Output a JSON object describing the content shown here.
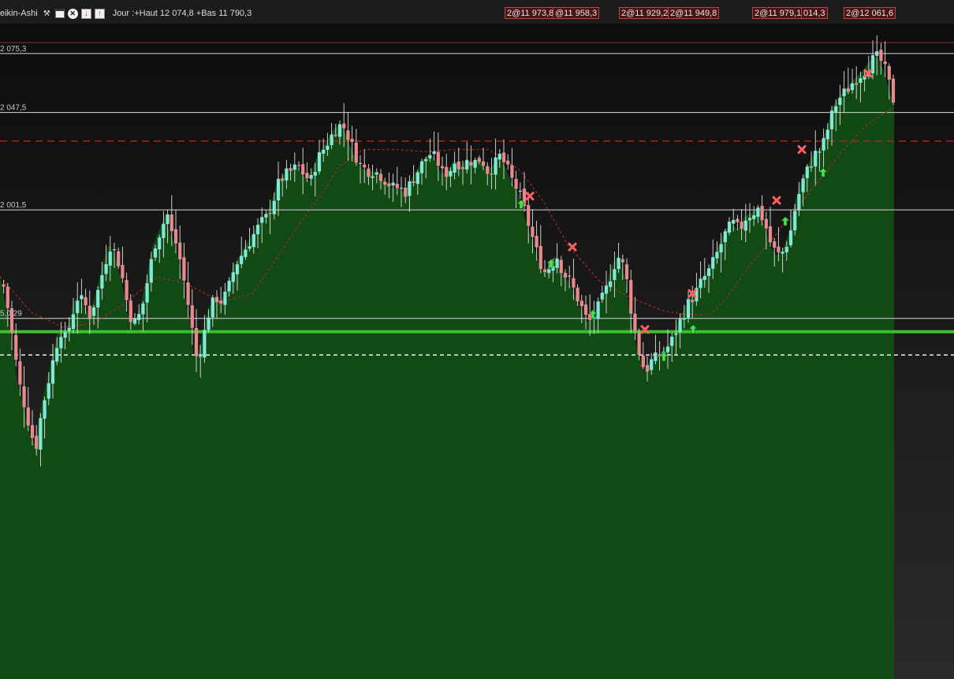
{
  "toolbar": {
    "style_name": "eikin-Ashi",
    "info_text": "Jour :+Haut 12 074,8 +Bas 11 790,3",
    "icons": [
      "wrench-icon",
      "window-icon",
      "close-icon",
      "sell-arrow-icon",
      "buy-arrow-icon"
    ]
  },
  "order_tags": {
    "t1": "2@11 973,8",
    "t2": "@11 958,3",
    "t3": "2@11 929,2",
    "t4": "2@11 949,8",
    "t5": "2@11 979,1",
    "t6": "014,3",
    "t7": "2@12 061,6"
  },
  "level_labels": {
    "l1": "2 075,3",
    "l2": "2 047,5",
    "l3": "2 001,5",
    "l4": "5,0,29"
  },
  "colors": {
    "background_top": "#0c0c0c",
    "background_bottom": "#2a2a2a",
    "bull_candle": "#7fe8d8",
    "bear_candle": "#e88a8a",
    "area_fill": "#124d14",
    "moving_average": "#b02828",
    "resistance_dashed": "#c02828",
    "support_line": "#3cbf32",
    "buy_marker": "#4fe04f",
    "sell_marker": "#ff6060"
  },
  "chart_data": {
    "type": "candlestick",
    "title": "",
    "xlabel": "",
    "ylabel": "",
    "ylim": [
      11780,
      12079
    ],
    "grid": false,
    "horizontal_levels": [
      12075.3,
      12047.5,
      12001.5,
      11950.29
    ],
    "resistance_level": 12034,
    "support_level": 11944,
    "dashed_level": 11933,
    "close_path": [
      [
        0,
        11970
      ],
      [
        8,
        11955
      ],
      [
        16,
        11935
      ],
      [
        22,
        11920
      ],
      [
        30,
        11908
      ],
      [
        38,
        11895
      ],
      [
        45,
        11890
      ],
      [
        50,
        11905
      ],
      [
        56,
        11915
      ],
      [
        62,
        11925
      ],
      [
        68,
        11935
      ],
      [
        74,
        11945
      ],
      [
        82,
        11940
      ],
      [
        88,
        11950
      ],
      [
        96,
        11960
      ],
      [
        104,
        11958
      ],
      [
        112,
        11952
      ],
      [
        120,
        11960
      ],
      [
        130,
        11975
      ],
      [
        138,
        11985
      ],
      [
        146,
        11980
      ],
      [
        154,
        11968
      ],
      [
        162,
        11952
      ],
      [
        170,
        11948
      ],
      [
        178,
        11955
      ],
      [
        186,
        11970
      ],
      [
        194,
        11985
      ],
      [
        202,
        11992
      ],
      [
        210,
        12000
      ],
      [
        216,
        11990
      ],
      [
        222,
        11985
      ],
      [
        228,
        11975
      ],
      [
        234,
        11962
      ],
      [
        240,
        11950
      ],
      [
        246,
        11932
      ],
      [
        252,
        11935
      ],
      [
        258,
        11945
      ],
      [
        264,
        11955
      ],
      [
        272,
        11960
      ],
      [
        280,
        11958
      ],
      [
        288,
        11965
      ],
      [
        296,
        11975
      ],
      [
        304,
        11980
      ],
      [
        312,
        11985
      ],
      [
        320,
        11990
      ],
      [
        328,
        11995
      ],
      [
        336,
        11998
      ],
      [
        344,
        12005
      ],
      [
        352,
        12015
      ],
      [
        360,
        12018
      ],
      [
        368,
        12020
      ],
      [
        376,
        12022
      ],
      [
        384,
        12018
      ],
      [
        392,
        12015
      ],
      [
        400,
        12025
      ],
      [
        408,
        12030
      ],
      [
        416,
        12035
      ],
      [
        424,
        12040
      ],
      [
        432,
        12042
      ],
      [
        440,
        12036
      ],
      [
        448,
        12028
      ],
      [
        456,
        12022
      ],
      [
        464,
        12020
      ],
      [
        472,
        12020
      ],
      [
        480,
        12018
      ],
      [
        488,
        12015
      ],
      [
        496,
        12012
      ],
      [
        504,
        12012
      ],
      [
        512,
        12010
      ],
      [
        520,
        12015
      ],
      [
        528,
        12020
      ],
      [
        536,
        12025
      ],
      [
        544,
        12028
      ],
      [
        552,
        12025
      ],
      [
        560,
        12018
      ],
      [
        568,
        12020
      ],
      [
        576,
        12025
      ],
      [
        584,
        12022
      ],
      [
        592,
        12025
      ],
      [
        600,
        12024
      ],
      [
        608,
        12026
      ],
      [
        616,
        12020
      ],
      [
        624,
        12022
      ],
      [
        632,
        12027
      ],
      [
        640,
        12022
      ],
      [
        648,
        12015
      ],
      [
        656,
        12010
      ],
      [
        664,
        12000
      ],
      [
        672,
        11990
      ],
      [
        680,
        11980
      ],
      [
        688,
        11972
      ],
      [
        696,
        11975
      ],
      [
        704,
        11980
      ],
      [
        712,
        11972
      ],
      [
        720,
        11968
      ],
      [
        728,
        11962
      ],
      [
        736,
        11955
      ],
      [
        744,
        11948
      ],
      [
        752,
        11952
      ],
      [
        760,
        11958
      ],
      [
        768,
        11965
      ],
      [
        776,
        11975
      ],
      [
        784,
        11980
      ],
      [
        792,
        11970
      ],
      [
        800,
        11950
      ],
      [
        808,
        11935
      ],
      [
        816,
        11925
      ],
      [
        824,
        11930
      ],
      [
        832,
        11932
      ],
      [
        840,
        11935
      ],
      [
        848,
        11938
      ],
      [
        856,
        11945
      ],
      [
        864,
        11952
      ],
      [
        872,
        11958
      ],
      [
        880,
        11962
      ],
      [
        888,
        11968
      ],
      [
        896,
        11972
      ],
      [
        904,
        11978
      ],
      [
        912,
        11985
      ],
      [
        920,
        11992
      ],
      [
        928,
        11995
      ],
      [
        936,
        11992
      ],
      [
        944,
        11998
      ],
      [
        952,
        12000
      ],
      [
        960,
        12002
      ],
      [
        968,
        11995
      ],
      [
        976,
        11985
      ],
      [
        984,
        11980
      ],
      [
        992,
        11982
      ],
      [
        1000,
        11990
      ],
      [
        1008,
        12005
      ],
      [
        1016,
        12015
      ],
      [
        1024,
        12022
      ],
      [
        1032,
        12028
      ],
      [
        1040,
        12030
      ],
      [
        1048,
        12040
      ],
      [
        1056,
        12050
      ],
      [
        1064,
        12055
      ],
      [
        1072,
        12058
      ],
      [
        1080,
        12062
      ],
      [
        1088,
        12065
      ],
      [
        1096,
        12068
      ],
      [
        1104,
        12072
      ],
      [
        1112,
        12074
      ],
      [
        1120,
        12068
      ],
      [
        1128,
        12058
      ],
      [
        1134,
        12049
      ]
    ],
    "moving_average": [
      [
        0,
        11970
      ],
      [
        40,
        11953
      ],
      [
        80,
        11946
      ],
      [
        120,
        11948
      ],
      [
        160,
        11958
      ],
      [
        200,
        11970
      ],
      [
        240,
        11966
      ],
      [
        280,
        11958
      ],
      [
        320,
        11962
      ],
      [
        350,
        11978
      ],
      [
        380,
        11995
      ],
      [
        410,
        12010
      ],
      [
        430,
        12022
      ],
      [
        460,
        12030
      ],
      [
        500,
        12030
      ],
      [
        540,
        12029
      ],
      [
        580,
        12030
      ],
      [
        620,
        12030
      ],
      [
        660,
        12020
      ],
      [
        690,
        12005
      ],
      [
        720,
        11985
      ],
      [
        760,
        11968
      ],
      [
        800,
        11960
      ],
      [
        840,
        11954
      ],
      [
        870,
        11952
      ],
      [
        900,
        11952
      ],
      [
        920,
        11959
      ],
      [
        950,
        11975
      ],
      [
        980,
        11988
      ],
      [
        1010,
        12002
      ],
      [
        1040,
        12016
      ],
      [
        1070,
        12030
      ],
      [
        1100,
        12042
      ],
      [
        1134,
        12050
      ]
    ],
    "sell_markers": [
      [
        818,
        11945
      ],
      [
        878,
        11962
      ],
      [
        672,
        12008
      ],
      [
        726,
        11984
      ],
      [
        985,
        12006
      ],
      [
        1017,
        12030
      ],
      [
        1101,
        12066
      ]
    ],
    "buy_markers": [
      [
        661,
        12004
      ],
      [
        699,
        11976
      ],
      [
        752,
        11952
      ],
      [
        842,
        11932
      ],
      [
        879,
        11945
      ],
      [
        996,
        11996
      ],
      [
        1044,
        12019
      ]
    ]
  }
}
